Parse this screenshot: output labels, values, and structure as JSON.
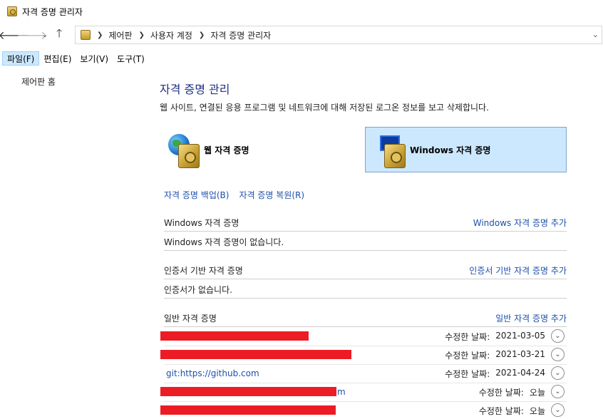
{
  "window": {
    "title": "자격 증명 관리자"
  },
  "nav": {
    "back_icon": "arrow-left-icon",
    "forward_icon": "arrow-right-icon",
    "up_icon": "arrow-up-icon",
    "breadcrumb": [
      "제어판",
      "사용자 계정",
      "자격 증명 관리자"
    ]
  },
  "menu": {
    "items": [
      "파일(F)",
      "편집(E)",
      "보기(V)",
      "도구(T)"
    ],
    "active_index": 0
  },
  "sidebar": {
    "home_label": "제어판 홈"
  },
  "main": {
    "title": "자격 증명 관리",
    "description": "웹 사이트, 연결된 응용 프로그램 및 네트워크에 대해 저장된 로그온 정보를 보고 삭제합니다.",
    "tiles": {
      "web": "웹 자격 증명",
      "windows": "Windows 자격 증명"
    },
    "links": {
      "backup": "자격 증명 백업(B)",
      "restore": "자격 증명 복원(R)"
    },
    "sections": {
      "windows": {
        "heading": "Windows 자격 증명",
        "add_link": "Windows 자격 증명 추가",
        "empty": "Windows 자격 증명이 없습니다."
      },
      "certificate": {
        "heading": "인증서 기반 자격 증명",
        "add_link": "인증서 기반 자격 증명 추가",
        "empty": "인증서가 없습니다."
      },
      "generic": {
        "heading": "일반 자격 증명",
        "add_link": "일반 자격 증명 추가",
        "modified_label": "수정한 날짜:",
        "rows": [
          {
            "name": "",
            "tail": "",
            "modified": "2021-03-05"
          },
          {
            "name": "",
            "tail": "",
            "modified": "2021-03-21"
          },
          {
            "name": "git:https://github.com",
            "tail": "",
            "modified": "2021-04-24"
          },
          {
            "name": "",
            "tail": "m",
            "modified": "오늘"
          },
          {
            "name": "",
            "tail": "",
            "modified": "오늘"
          }
        ]
      }
    }
  },
  "colors": {
    "accent": "#1e4fa8",
    "title": "#1e3287",
    "selected_tile": "#cce8ff",
    "redaction": "#ec1c24"
  }
}
